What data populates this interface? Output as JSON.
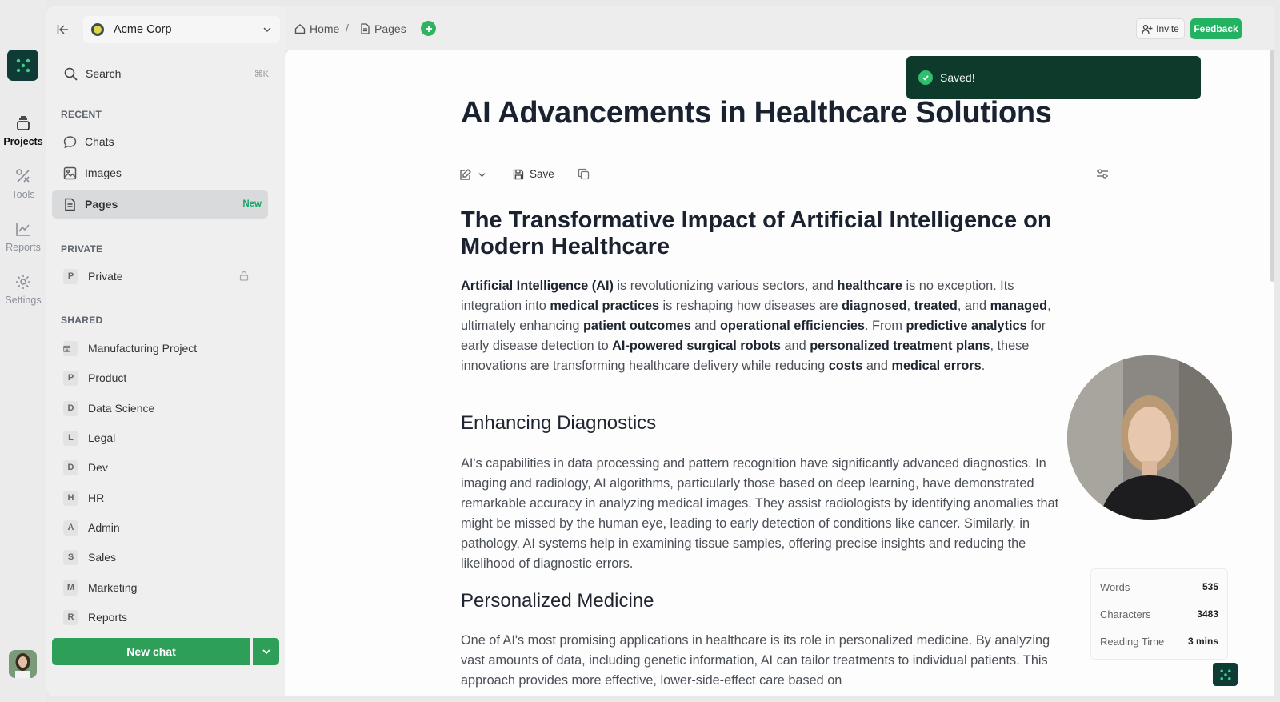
{
  "rail": {
    "items": [
      {
        "label": "Projects",
        "icon": "projects-icon"
      },
      {
        "label": "Tools",
        "icon": "tools-icon"
      },
      {
        "label": "Reports",
        "icon": "reports-icon"
      },
      {
        "label": "Settings",
        "icon": "gear-icon"
      }
    ]
  },
  "sidebar": {
    "org": "Acme Corp",
    "search": {
      "label": "Search",
      "shortcut": "⌘K"
    },
    "recent_label": "RECENT",
    "recent": [
      {
        "label": "Chats",
        "icon": "chat-icon"
      },
      {
        "label": "Images",
        "icon": "image-icon"
      },
      {
        "label": "Pages",
        "icon": "page-icon",
        "badge": "New"
      }
    ],
    "private_label": "PRIVATE",
    "private": [
      {
        "letter": "P",
        "label": "Private"
      }
    ],
    "shared_label": "SHARED",
    "shared": [
      {
        "letter": "",
        "label": "Manufacturing Project"
      },
      {
        "letter": "P",
        "label": "Product"
      },
      {
        "letter": "D",
        "label": "Data Science"
      },
      {
        "letter": "L",
        "label": "Legal"
      },
      {
        "letter": "D",
        "label": "Dev"
      },
      {
        "letter": "H",
        "label": "HR"
      },
      {
        "letter": "A",
        "label": "Admin"
      },
      {
        "letter": "S",
        "label": "Sales"
      },
      {
        "letter": "M",
        "label": "Marketing"
      },
      {
        "letter": "R",
        "label": "Reports"
      }
    ],
    "new_chat": "New chat"
  },
  "topbar": {
    "crumbs": [
      "Home",
      "/",
      "Pages"
    ],
    "invite": "Invite",
    "feedback": "Feedback"
  },
  "toast": {
    "text": "Saved!"
  },
  "doc": {
    "title": "AI Advancements in Healthcare Solutions",
    "toolbar": {
      "save": "Save"
    },
    "h1": "The Transformative Impact of Artificial Intelligence on Modern Healthcare",
    "p1": [
      {
        "t": "Artificial Intelligence (AI)",
        "b": true
      },
      {
        "t": " is revolutionizing various sectors, and "
      },
      {
        "t": "healthcare",
        "b": true
      },
      {
        "t": " is no exception. Its integration into "
      },
      {
        "t": "medical practices",
        "b": true
      },
      {
        "t": " is reshaping how diseases are "
      },
      {
        "t": "diagnosed",
        "b": true
      },
      {
        "t": ", "
      },
      {
        "t": "treated",
        "b": true
      },
      {
        "t": ", and "
      },
      {
        "t": "managed",
        "b": true
      },
      {
        "t": ", ultimately enhancing "
      },
      {
        "t": "patient outcomes",
        "b": true
      },
      {
        "t": " and "
      },
      {
        "t": "operational efficiencies",
        "b": true
      },
      {
        "t": ". From "
      },
      {
        "t": "predictive analytics",
        "b": true
      },
      {
        "t": " for early disease detection to "
      },
      {
        "t": "AI-powered surgical robots",
        "b": true
      },
      {
        "t": " and "
      },
      {
        "t": "personalized treatment plans",
        "b": true
      },
      {
        "t": ", these innovations are transforming healthcare delivery while reducing "
      },
      {
        "t": "costs",
        "b": true
      },
      {
        "t": " and "
      },
      {
        "t": "medical errors",
        "b": true
      },
      {
        "t": "."
      }
    ],
    "h2a": "Enhancing Diagnostics",
    "p2": "AI's capabilities in data processing and pattern recognition have significantly advanced diagnostics. In imaging and radiology, AI algorithms, particularly those based on deep learning, have demonstrated remarkable accuracy in analyzing medical images. They assist radiologists by identifying anomalies that might be missed by the human eye, leading to early detection of conditions like cancer. Similarly, in pathology, AI systems help in examining tissue samples, offering precise insights and reducing the likelihood of diagnostic errors.",
    "h2b": "Personalized Medicine",
    "p3": "One of AI's most promising applications in healthcare is its role in personalized medicine. By analyzing vast amounts of data, including genetic information, AI can tailor treatments to individual patients. This approach provides more effective, lower-side-effect care based on"
  },
  "stats": [
    {
      "label": "Words",
      "value": "535"
    },
    {
      "label": "Characters",
      "value": "3483"
    },
    {
      "label": "Reading Time",
      "value": "3 mins"
    }
  ],
  "colors": {
    "brand": "#0e3b36",
    "accent": "#22b261",
    "toast": "#0d3a2b"
  }
}
